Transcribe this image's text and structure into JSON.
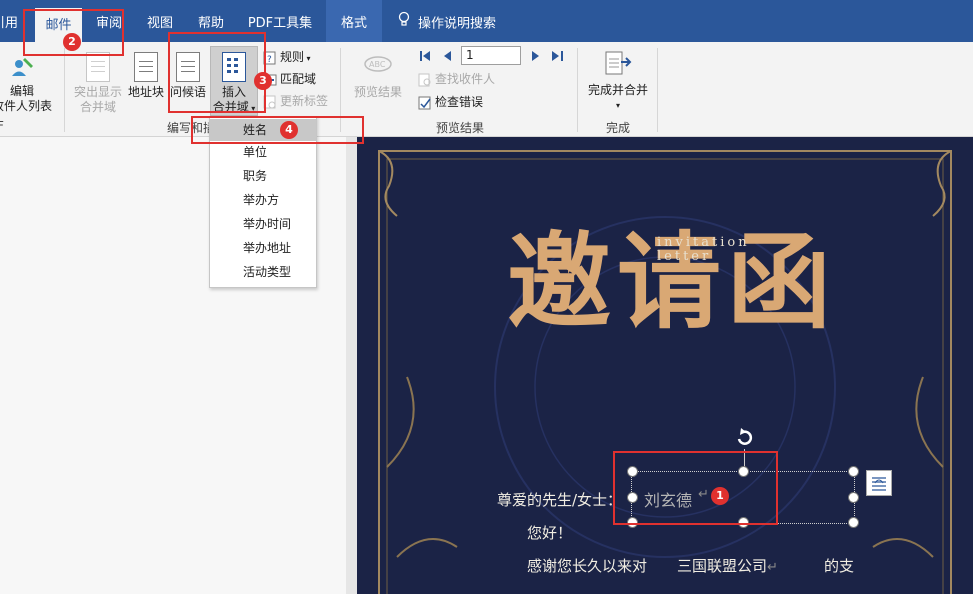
{
  "tabs": [
    {
      "id": "references",
      "label": "引用"
    },
    {
      "id": "mailings",
      "label": "邮件",
      "active": true
    },
    {
      "id": "review",
      "label": "审阅"
    },
    {
      "id": "view",
      "label": "视图"
    },
    {
      "id": "help",
      "label": "帮助"
    },
    {
      "id": "pdf",
      "label": "PDF工具集"
    },
    {
      "id": "format",
      "label": "格式"
    },
    {
      "id": "tellme",
      "label": "操作说明搜索"
    }
  ],
  "ribbon": {
    "edit_list": {
      "line1": "编辑",
      "line2": "收件人列表"
    },
    "highlight": {
      "line1": "突出显示",
      "line2": "合并域"
    },
    "address_block": "地址块",
    "greeting": "问候语",
    "insert_field": {
      "line1": "插入",
      "line2": "合并域"
    },
    "rules": "规则",
    "match_fields": "匹配域",
    "update_labels": "更新标签",
    "group_write": "编写和插",
    "preview_results": "预览结果",
    "record_value": "1",
    "find_recipient": "查找收件人",
    "check_errors": "检查错误",
    "group_preview": "预览结果",
    "finish_merge": "完成并合并",
    "group_finish": "完成"
  },
  "dropdown": {
    "items": [
      "姓名",
      "单位",
      "职务",
      "举办方",
      "举办时间",
      "举办地址",
      "活动类型"
    ],
    "selected": "姓名"
  },
  "card": {
    "title_cn": "邀请函",
    "title_en_1": "invitation",
    "title_en_2": "letter",
    "salutation": "尊爱的先生/女士：",
    "name_field": "刘玄德",
    "hello": "您好！",
    "thanks_prefix": "感谢您长久以来对",
    "company": "三国联盟公司",
    "thanks_suffix": "的支"
  },
  "annotations": [
    "1",
    "2",
    "3",
    "4"
  ],
  "colors": {
    "ribbon_blue": "#2b579a",
    "annotation_red": "#e0312f",
    "card_navy": "#1b2346",
    "gold": "#d9a874"
  }
}
